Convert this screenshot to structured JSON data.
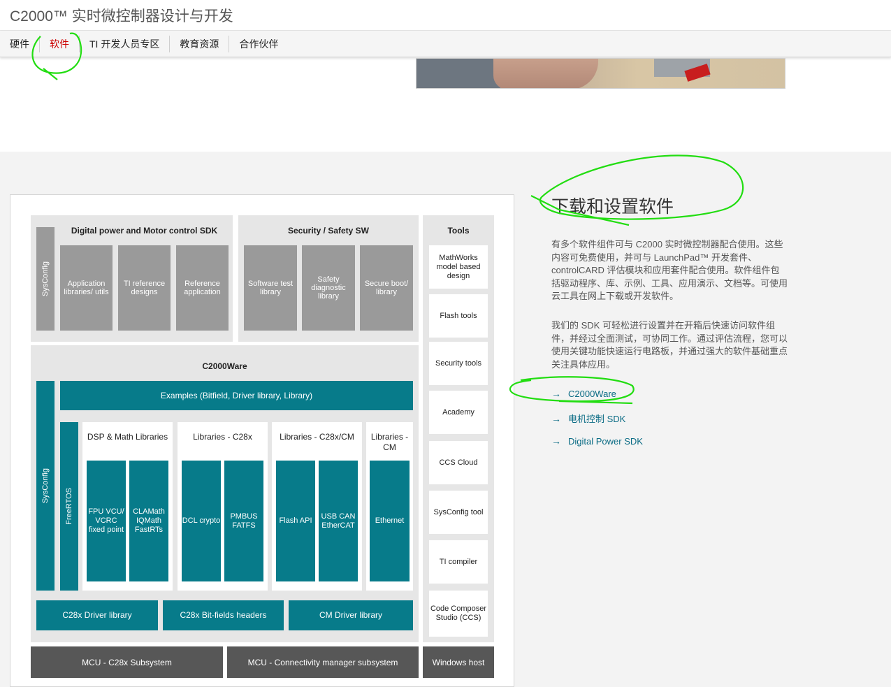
{
  "header": {
    "title": "C2000™ 实时微控制器设计与开发"
  },
  "nav": {
    "items": [
      "硬件",
      "软件",
      "TI 开发人员专区",
      "教育资源",
      "合作伙伴"
    ],
    "active": "软件"
  },
  "diagram": {
    "motor_sdk": {
      "title": "Digital power and Motor control SDK",
      "sysconfig": "SysConfig",
      "items": [
        "Application libraries/ utils",
        "TI reference designs",
        "Reference application"
      ]
    },
    "security": {
      "title": "Security / Safety SW",
      "items": [
        "Software test library",
        "Safety diagnostic library",
        "Secure boot/ library"
      ]
    },
    "tools": {
      "title": "Tools",
      "items": [
        "MathWorks model based design",
        "Flash tools",
        "Security tools",
        "Academy",
        "CCS Cloud",
        "SysConfig tool",
        "TI compiler",
        "Code Composer Studio (CCS)"
      ]
    },
    "c2000ware": {
      "title": "C2000Ware",
      "sysconfig": "SysConfig",
      "freertos": "FreeRTOS",
      "examples": "Examples (Bitfield, Driver library, Library)",
      "groups": [
        {
          "title": "DSP & Math Libraries",
          "items": [
            "FPU VCU/ VCRC fixed point",
            "CLAMath IQMath FastRTs"
          ]
        },
        {
          "title": "Libraries - C28x",
          "items": [
            "DCL crypto",
            "PMBUS FATFS"
          ]
        },
        {
          "title": "Libraries - C28x/CM",
          "items": [
            "Flash API",
            "USB CAN EtherCAT"
          ]
        },
        {
          "title": "Libraries - CM",
          "items": [
            "Ethernet"
          ]
        }
      ],
      "drivers": [
        "C28x Driver library",
        "C28x Bit-fields headers",
        "CM Driver library"
      ]
    },
    "bottom": [
      "MCU - C28x Subsystem",
      "MCU - Connectivity manager subsystem",
      "Windows host"
    ]
  },
  "right": {
    "title": "下载和设置软件",
    "para1": "有多个软件组件可与 C2000 实时微控制器配合使用。这些内容可免费使用，并可与 LaunchPad™ 开发套件、controlCARD 评估模块和应用套件配合使用。软件组件包括驱动程序、库、示例、工具、应用演示、文档等。可使用云工具在网上下载或开发软件。",
    "para2": "我们的 SDK 可轻松进行设置并在开箱后快速访问软件组件，并经过全面测试，可协同工作。通过评估流程，您可以使用关键功能快速运行电路板，并通过强大的软件基础重点关注具体应用。",
    "links": [
      "C2000Ware",
      "电机控制 SDK",
      "Digital Power SDK"
    ]
  },
  "colors": {
    "teal": "#077b8a",
    "gray_block": "#9a9a9a",
    "dark_block": "#575757",
    "annotation": "#22dd11",
    "active_nav": "#cc0000"
  }
}
